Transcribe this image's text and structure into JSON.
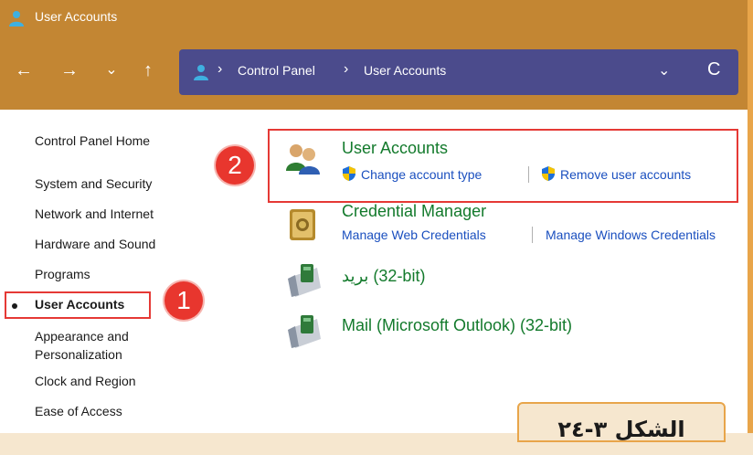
{
  "window": {
    "title": "User Accounts"
  },
  "nav": {
    "back_icon": "←",
    "forward_icon": "→",
    "recent_icon": "⌄",
    "up_icon": "↑"
  },
  "address": {
    "breadcrumb": [
      "Control Panel",
      "User Accounts"
    ],
    "separator": "›",
    "dropdown_icon": "⌄",
    "refresh_icon": "C"
  },
  "sidebar": {
    "items": [
      {
        "label": "Control Panel Home"
      },
      {
        "label": "System and Security"
      },
      {
        "label": "Network and Internet"
      },
      {
        "label": "Hardware and Sound"
      },
      {
        "label": "Programs"
      },
      {
        "label": "User Accounts",
        "active": true
      },
      {
        "label": "Appearance and"
      },
      {
        "label": "Personalization"
      },
      {
        "label": "Clock and Region"
      },
      {
        "label": "Ease of Access"
      }
    ]
  },
  "main": {
    "entries": [
      {
        "title": "User Accounts",
        "links": [
          "Change account type",
          "Remove user accounts"
        ]
      },
      {
        "title": "Credential Manager",
        "links": [
          "Manage Web Credentials",
          "Manage Windows Credentials"
        ]
      },
      {
        "title": "بريد (32-bit)"
      },
      {
        "title": "Mail (Microsoft Outlook) (32-bit)"
      }
    ]
  },
  "annotations": {
    "badge1": "1",
    "badge2": "2"
  },
  "caption": "الشكل ٣-٢٤",
  "colors": {
    "title_bar": "#c38633",
    "address_bar": "#4b4b8c",
    "entry_title": "#137a2c",
    "link": "#1a4fbf",
    "highlight": "#e53935"
  }
}
